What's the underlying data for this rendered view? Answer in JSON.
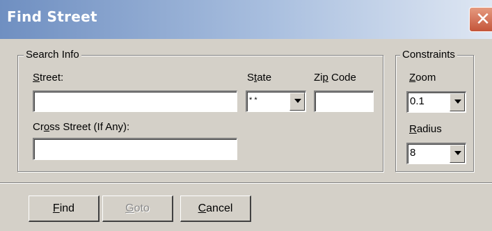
{
  "window": {
    "title": "Find Street",
    "close_label": "✕"
  },
  "search_info": {
    "legend": "Search Info",
    "street": {
      "label_pre": "",
      "label_key": "S",
      "label_post": "treet:",
      "value": ""
    },
    "state": {
      "label_pre": "S",
      "label_key": "t",
      "label_post": "ate",
      "value": "* *"
    },
    "zip": {
      "label_pre": "Zi",
      "label_key": "p",
      "label_post": " Code",
      "value": ""
    },
    "cross": {
      "label_pre": "Cr",
      "label_key": "o",
      "label_post": "ss Street (If Any):",
      "value": ""
    }
  },
  "constraints": {
    "legend": "Constraints",
    "zoom": {
      "label_pre": "",
      "label_key": "Z",
      "label_post": "oom",
      "value": "0.1"
    },
    "radius": {
      "label_pre": "",
      "label_key": "R",
      "label_post": "adius",
      "value": "8"
    }
  },
  "buttons": {
    "find": {
      "key": "F",
      "rest": "ind",
      "enabled": true
    },
    "goto": {
      "key": "G",
      "rest": "oto",
      "enabled": false
    },
    "cancel": {
      "key": "C",
      "rest": "ancel",
      "enabled": true
    }
  }
}
